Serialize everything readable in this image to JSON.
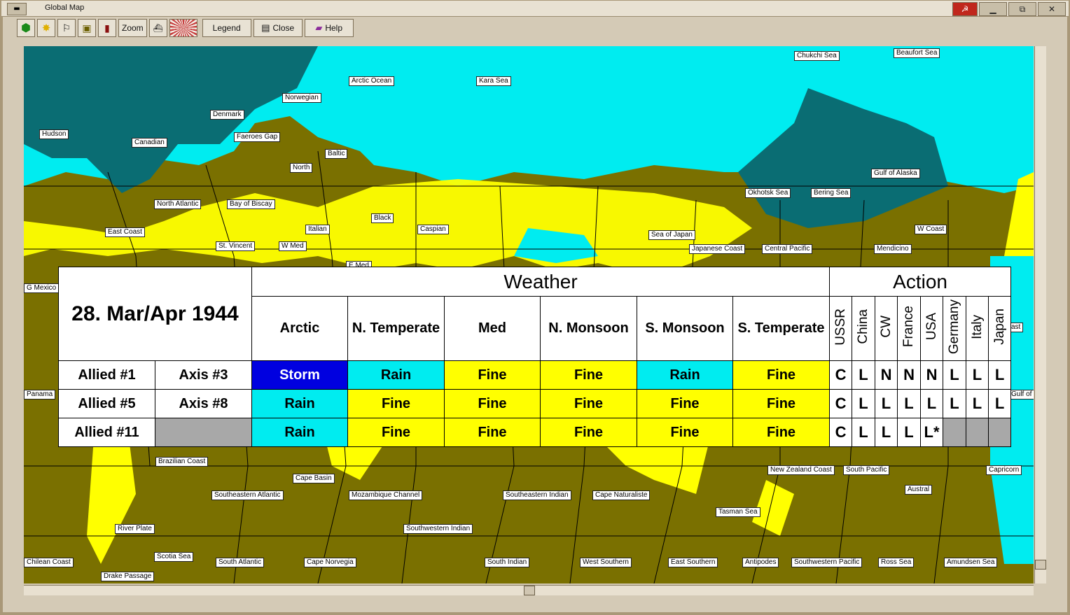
{
  "window": {
    "title": "Global Map",
    "sys_label": "▬"
  },
  "toolbar": {
    "zoom_label": "Zoom",
    "legend_label": "Legend",
    "close_label": "Close",
    "help_label": "Help"
  },
  "colors": {
    "storm": "#0000e0",
    "rain": "#00ecf0",
    "fine": "#ffff00",
    "land": "#7a7000",
    "arctic": "#0a6d73",
    "temperate_sea": "#00ecf0"
  },
  "map_labels": [
    "Chukchi Sea",
    "Beaufort Sea",
    "Arctic Ocean",
    "Kara Sea",
    "Norwegian",
    "Denmark",
    "Hudson",
    "Canadian",
    "Faeroes Gap",
    "Baltic",
    "North",
    "Gulf of Alaska",
    "Okhotsk Sea",
    "Bering Sea",
    "North Atlantic",
    "Bay of Biscay",
    "Black",
    "Caspian",
    "East Coast",
    "Italian",
    "Sea of Japan",
    "W Coast",
    "St. Vincent",
    "W Med",
    "Japanese Coast",
    "Central Pacific",
    "Mendicino",
    "E Med",
    "G Mexico",
    "ast",
    "Panama",
    "Gulf of",
    "Brazilian Coast",
    "New Zealand Coast",
    "South Pacific",
    "Capricorn",
    "Cape Basin",
    "Austral",
    "Southeastern Atlantic",
    "Mozambique Channel",
    "Southeastern Indian",
    "Cape Naturaliste",
    "Tasman Sea",
    "River Plate",
    "Southwestern Indian",
    "Scotia Sea",
    "Chilean Coast",
    "South Atlantic",
    "Cape Norvegia",
    "South Indian",
    "West Southern",
    "East Southern",
    "Antipodes",
    "Southwestern Pacific",
    "Ross Sea",
    "Amundsen Sea",
    "Drake Passage"
  ],
  "weather_table": {
    "date": "28.  Mar/Apr 1944",
    "weather_header": "Weather",
    "action_header": "Action",
    "zones": [
      "Arctic",
      "N. Temperate",
      "Med",
      "N. Monsoon",
      "S. Monsoon",
      "S. Temperate"
    ],
    "nations": [
      "USSR",
      "China",
      "CW",
      "France",
      "USA",
      "Germany",
      "Italy",
      "Japan"
    ],
    "rows": [
      {
        "allied": "Allied #1",
        "axis": "Axis #3",
        "weather": [
          "Storm",
          "Rain",
          "Fine",
          "Fine",
          "Rain",
          "Fine"
        ],
        "action": [
          "C",
          "L",
          "N",
          "N",
          "N",
          "L",
          "L",
          "L"
        ]
      },
      {
        "allied": "Allied #5",
        "axis": "Axis #8",
        "weather": [
          "Rain",
          "Fine",
          "Fine",
          "Fine",
          "Fine",
          "Fine"
        ],
        "action": [
          "C",
          "L",
          "L",
          "L",
          "L",
          "L",
          "L",
          "L"
        ]
      },
      {
        "allied": "Allied #11",
        "axis": "",
        "weather": [
          "Rain",
          "Fine",
          "Fine",
          "Fine",
          "Fine",
          "Fine"
        ],
        "action": [
          "C",
          "L",
          "L",
          "L",
          "L*",
          "",
          "",
          ""
        ]
      }
    ]
  }
}
